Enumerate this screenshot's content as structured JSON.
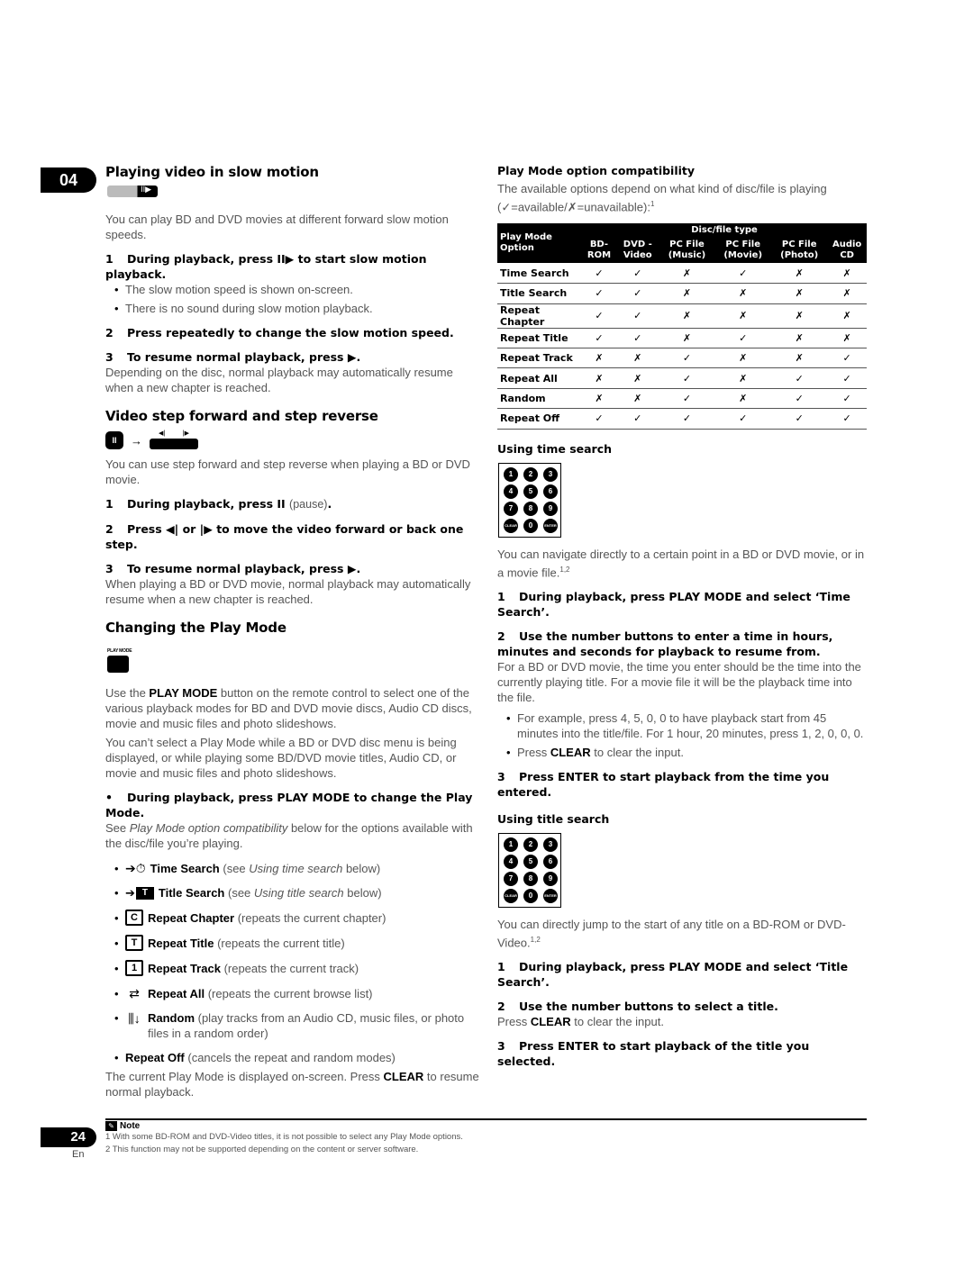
{
  "chapter_number": "04",
  "page": {
    "number": "24",
    "lang": "En"
  },
  "slow_motion": {
    "title": "Playing video in slow motion",
    "button_glyph": "II▶",
    "intro": "You can play BD and DVD movies at different forward slow motion speeds.",
    "step1_num": "1",
    "step1": "During playback, press II▶ to start slow motion playback.",
    "bullets": [
      "The slow motion speed is shown on-screen.",
      "There is no sound during slow motion playback."
    ],
    "step2_num": "2",
    "step2": "Press repeatedly to change the slow motion speed.",
    "step3_num": "3",
    "step3": "To resume normal playback, press ▶.",
    "step3_text": "Depending on the disc, normal playback may automatically resume when a new chapter is reached."
  },
  "step_frame": {
    "title": "Video step forward and step reverse",
    "pause_glyph": "II",
    "arrow": "→",
    "step_back_glyph": "◀|",
    "step_fwd_glyph": "|▶",
    "intro": "You can use step forward and step reverse when playing a BD or DVD movie.",
    "step1_num": "1",
    "step1_bold": "During playback, press II",
    "step1_light": "(pause)",
    "step1_end": ".",
    "step2_num": "2",
    "step2": "Press ◀| or |▶ to move the video forward or back one step.",
    "step3_num": "3",
    "step3": "To resume normal playback, press ▶.",
    "step3_text": "When playing a BD or DVD movie, normal playback may automatically resume when a new chapter is reached."
  },
  "play_mode": {
    "title": "Changing the Play Mode",
    "button_label": "PLAY MODE",
    "para1_pre": "Use the ",
    "para1_bold": "PLAY MODE",
    "para1_post": " button on the remote control to select one of the various playback modes for BD and DVD movie discs, Audio CD discs, movie and music files and photo slideshows.",
    "para2": "You can’t select a Play Mode while a BD or DVD disc menu is being displayed, or while playing some BD/DVD movie titles, Audio CD, or movie and music files and photo slideshows.",
    "instruction": "During playback, press PLAY MODE to change the Play Mode.",
    "see_pre": "See ",
    "see_italic": "Play Mode option compatibility",
    "see_post": " below for the options available with the disc/file you’re playing.",
    "modes": [
      {
        "icon": "time-search-icon",
        "glyph": "➔⏱",
        "name": "Time Search",
        "desc_pre": "(see ",
        "desc_italic": "Using time search",
        "desc_post": " below)"
      },
      {
        "icon": "title-search-icon",
        "glyph": "T",
        "name": "Title Search",
        "desc_pre": "(see ",
        "desc_italic": "Using title search",
        "desc_post": " below)"
      },
      {
        "icon": "repeat-chapter-icon",
        "glyph": "C",
        "name": "Repeat Chapter",
        "desc_pre": "(repeats the current chapter)",
        "desc_italic": "",
        "desc_post": ""
      },
      {
        "icon": "repeat-title-icon",
        "glyph": "T",
        "name": "Repeat Title",
        "desc_pre": "(repeats the current title)",
        "desc_italic": "",
        "desc_post": ""
      },
      {
        "icon": "repeat-track-icon",
        "glyph": "1",
        "name": "Repeat Track",
        "desc_pre": "(repeats the current track)",
        "desc_italic": "",
        "desc_post": ""
      },
      {
        "icon": "repeat-all-icon",
        "glyph": "⇄",
        "name": "Repeat All",
        "desc_pre": "(repeats the current browse list)",
        "desc_italic": "",
        "desc_post": ""
      },
      {
        "icon": "random-icon",
        "glyph": "⫼↓",
        "name": "Random",
        "desc_pre": "(play tracks from an Audio CD, music files, or photo files in a random order)",
        "desc_italic": "",
        "desc_post": ""
      },
      {
        "icon": "",
        "glyph": "",
        "name": "Repeat Off",
        "desc_pre": "(cancels the repeat and random modes)",
        "desc_italic": "",
        "desc_post": ""
      }
    ],
    "footer_pre": "The current Play Mode is displayed on-screen. Press ",
    "footer_bold": "CLEAR",
    "footer_post": " to resume normal playback."
  },
  "compatibility": {
    "title": "Play Mode option compatibility",
    "intro": "The available options depend on what kind of disc/file is playing",
    "legend": "(✓=available/✗=unavailable):",
    "legend_footnote": "1",
    "table": {
      "row_header": "Play Mode Option",
      "group_header": "Disc/file type",
      "columns": [
        "BD-ROM",
        "DVD -Video",
        "PC File (Music)",
        "PC File (Movie)",
        "PC File (Photo)",
        "Audio CD"
      ],
      "rows": [
        {
          "label": "Time Search",
          "cells": [
            "✓",
            "✓",
            "✗",
            "✓",
            "✗",
            "✗"
          ]
        },
        {
          "label": "Title Search",
          "cells": [
            "✓",
            "✓",
            "✗",
            "✗",
            "✗",
            "✗"
          ]
        },
        {
          "label": "Repeat Chapter",
          "cells": [
            "✓",
            "✓",
            "✗",
            "✗",
            "✗",
            "✗"
          ]
        },
        {
          "label": "Repeat Title",
          "cells": [
            "✓",
            "✓",
            "✗",
            "✓",
            "✗",
            "✗"
          ]
        },
        {
          "label": "Repeat Track",
          "cells": [
            "✗",
            "✗",
            "✓",
            "✗",
            "✗",
            "✓"
          ]
        },
        {
          "label": "Repeat All",
          "cells": [
            "✗",
            "✗",
            "✓",
            "✗",
            "✓",
            "✓"
          ]
        },
        {
          "label": "Random",
          "cells": [
            "✗",
            "✗",
            "✓",
            "✗",
            "✓",
            "✓"
          ]
        },
        {
          "label": "Repeat Off",
          "cells": [
            "✓",
            "✓",
            "✓",
            "✓",
            "✓",
            "✓"
          ]
        }
      ]
    }
  },
  "keypad_keys": [
    "1",
    "2",
    "3",
    "4",
    "5",
    "6",
    "7",
    "8",
    "9",
    "CLEAR",
    "0",
    "ENTER"
  ],
  "time_search": {
    "title": "Using time search",
    "intro": "You can navigate directly to a certain point in a BD or DVD movie, or in a movie file.",
    "intro_sup": "1,2",
    "step1_num": "1",
    "step1": "During playback, press PLAY MODE and select ‘Time Search’.",
    "step2_num": "2",
    "step2": "Use the number buttons to enter a time in hours, minutes and seconds for playback to resume from.",
    "step2_text": "For a BD or DVD movie, the time you enter should be the time into the currently playing title. For a movie file it will be the playback time into the file.",
    "bullet1": "For example, press 4, 5, 0, 0 to have playback start from 45 minutes into the title/file. For 1 hour, 20 minutes, press 1, 2, 0, 0, 0.",
    "bullet2_pre": "Press ",
    "bullet2_bold": "CLEAR",
    "bullet2_post": " to clear the input.",
    "step3_num": "3",
    "step3": "Press ENTER to start playback from the time you entered."
  },
  "title_search": {
    "title": "Using title search",
    "intro": "You can directly jump to the start of any title on a BD-ROM or DVD-Video.",
    "intro_sup": "1,2",
    "step1_num": "1",
    "step1": "During playback, press PLAY MODE and select ‘Title Search’.",
    "step2_num": "2",
    "step2": "Use the number buttons to select a title.",
    "step2_pre": "Press ",
    "step2_bold": "CLEAR",
    "step2_post": " to clear the input.",
    "step3_num": "3",
    "step3": "Press ENTER to start playback of the title you selected."
  },
  "note": {
    "title": "Note",
    "lines": [
      "1 With some BD-ROM and DVD-Video titles, it is not possible to select any Play Mode options.",
      "2 This function may not be supported depending on the content or server software."
    ]
  }
}
